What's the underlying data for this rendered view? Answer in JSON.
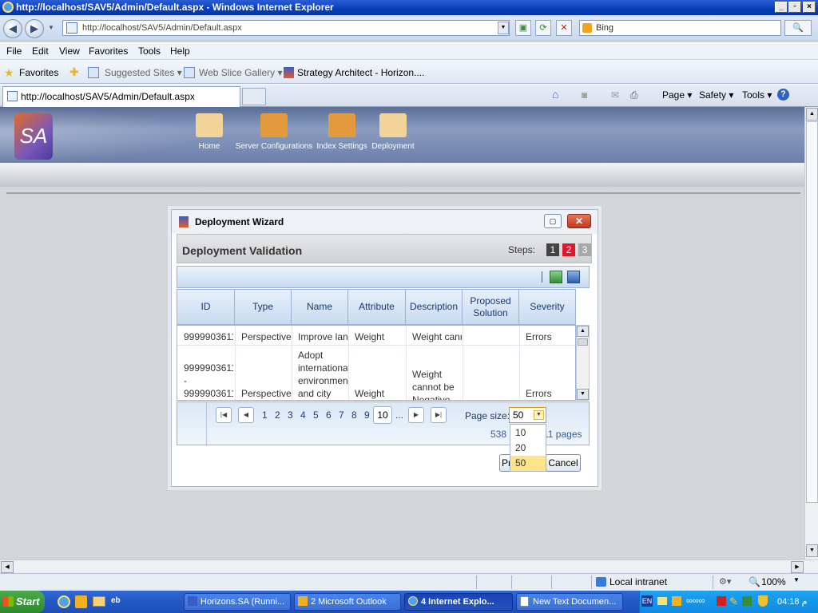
{
  "browser": {
    "window_title": "http://localhost/SAV5/Admin/Default.aspx - Windows Internet Explorer",
    "address": "http://localhost/SAV5/Admin/Default.aspx",
    "search_placeholder": "Bing",
    "menu": [
      "File",
      "Edit",
      "View",
      "Favorites",
      "Tools",
      "Help"
    ],
    "favorites_label": "Favorites",
    "suggested_sites": "Suggested Sites ▾",
    "web_slice_gallery": "Web Slice Gallery ▾",
    "strategy_architect": "Strategy Architect - Horizon....",
    "tab_title": "http://localhost/SAV5/Admin/Default.aspx",
    "commands": [
      "Page ▾",
      "Safety ▾",
      "Tools ▾"
    ],
    "status_zone": "Local intranet",
    "zoom": "100%"
  },
  "app": {
    "logo_text": "SA",
    "nav": [
      "Home",
      "Server Configurations",
      "Index Settings",
      "Deployment"
    ]
  },
  "dialog": {
    "title": "Deployment Wizard",
    "close_glyph": "✕",
    "section_title": "Deployment Validation",
    "steps_label": "Steps:",
    "steps": [
      "1",
      "2",
      "3"
    ],
    "columns": [
      "ID",
      "Type",
      "Name",
      "Attribute",
      "Description",
      "Proposed Solution",
      "Severity"
    ],
    "rows": [
      {
        "id": [
          "99999036117"
        ],
        "type": [
          "Perspective"
        ],
        "name": [
          "Improve lan"
        ],
        "attribute": [
          "Weight"
        ],
        "description": [
          "Weight cann"
        ],
        "solution": [
          ""
        ],
        "severity": [
          "Errors"
        ]
      },
      {
        "id": [
          "99999036117",
          "-",
          "99999036117"
        ],
        "type": [
          "Perspective"
        ],
        "name": [
          "Adopt",
          "internationa",
          "environmen",
          "and city"
        ],
        "attribute": [
          "Weight"
        ],
        "description": [
          "Weight",
          "cannot be",
          "Negative"
        ],
        "solution": [
          ""
        ],
        "severity": [
          "Errors"
        ]
      }
    ],
    "pager": {
      "pages": [
        "1",
        "2",
        "3",
        "4",
        "5",
        "6",
        "7",
        "8",
        "9"
      ],
      "current": "10",
      "ellipsis": "...",
      "page_size_label": "Page size:",
      "page_size_value": "50",
      "page_size_options": [
        "10",
        "20",
        "50"
      ],
      "items_total": "538",
      "pages_text": "11 pages"
    },
    "prev_button": "Pr",
    "cancel_button": "Cancel"
  },
  "taskbar": {
    "start": "Start",
    "tasks": [
      "Horizons.SA (Runni...",
      "2 Microsoft Outlook",
      "4 Internet Explo...",
      "New Text Documen..."
    ],
    "lang": "EN",
    "clock": "04:18 م"
  }
}
